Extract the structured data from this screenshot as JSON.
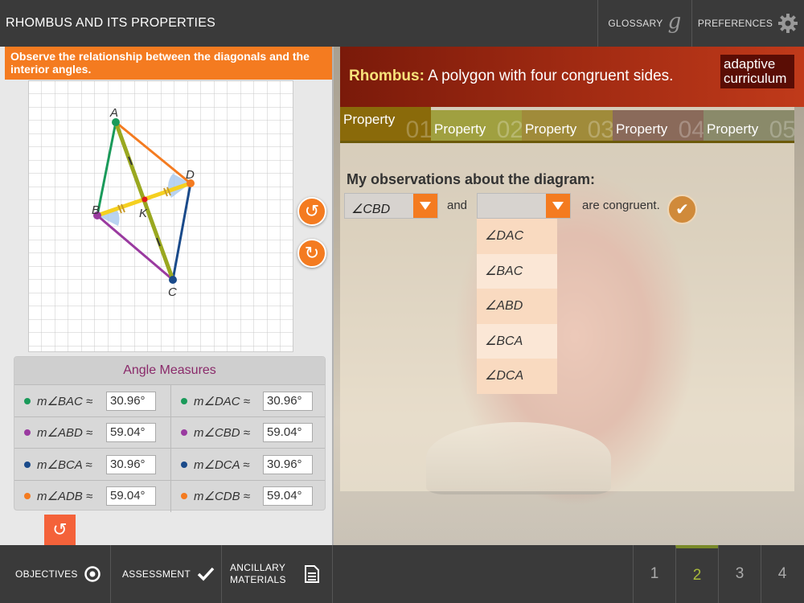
{
  "header": {
    "title": "RHOMBUS AND ITS PROPERTIES",
    "glossary_label": "GLOSSARY",
    "glossary_glyph": "g",
    "preferences_label": "PREFERENCES"
  },
  "left": {
    "instruction": "Observe the relationship between the diagonals and the interior angles.",
    "diagram": {
      "points": {
        "A": "A",
        "B": "B",
        "C": "C",
        "D": "D",
        "K": "K"
      }
    },
    "angle_panel": {
      "title": "Angle Measures",
      "rows": [
        {
          "l_name": "m∠BAC ≈",
          "l_val": "30.96°",
          "l_color": "#1a9a5a",
          "r_name": "m∠DAC ≈",
          "r_val": "30.96°",
          "r_color": "#1a9a5a"
        },
        {
          "l_name": "m∠ABD ≈",
          "l_val": "59.04°",
          "l_color": "#9a3aa0",
          "r_name": "m∠CBD ≈",
          "r_val": "59.04°",
          "r_color": "#9a3aa0"
        },
        {
          "l_name": "m∠BCA ≈",
          "l_val": "30.96°",
          "l_color": "#1a4a8a",
          "r_name": "m∠DCA ≈",
          "r_val": "30.96°",
          "r_color": "#1a4a8a"
        },
        {
          "l_name": "m∠ADB ≈",
          "l_val": "59.04°",
          "l_color": "#f47b20",
          "r_name": "m∠CDB ≈",
          "r_val": "59.04°",
          "r_color": "#f47b20"
        }
      ]
    }
  },
  "right": {
    "definition_term": "Rhombus:",
    "definition_text": " A polygon with four congruent sides.",
    "brand_line1": "adaptive",
    "brand_line2": "curriculum",
    "tabs": [
      {
        "label": "Property",
        "num": "01"
      },
      {
        "label": "Property",
        "num": "02"
      },
      {
        "label": "Property",
        "num": "03"
      },
      {
        "label": "Property",
        "num": "04"
      },
      {
        "label": "Property",
        "num": "05"
      }
    ],
    "observation_title": "My observations about the diagram:",
    "select1_value": "∠CBD",
    "select2_value": "",
    "and_text": "and",
    "congruent_text": "are congruent.",
    "dropdown_options": [
      "∠DAC",
      "∠BAC",
      "∠ABD",
      "∠BCA",
      "∠DCA"
    ]
  },
  "footer": {
    "objectives_label": "OBJECTIVES",
    "assessment_label": "ASSESSMENT",
    "ancillary_line1": "ANCILLARY",
    "ancillary_line2": "MATERIALS",
    "pages": [
      "1",
      "2",
      "3",
      "4"
    ],
    "active_page": "2"
  }
}
